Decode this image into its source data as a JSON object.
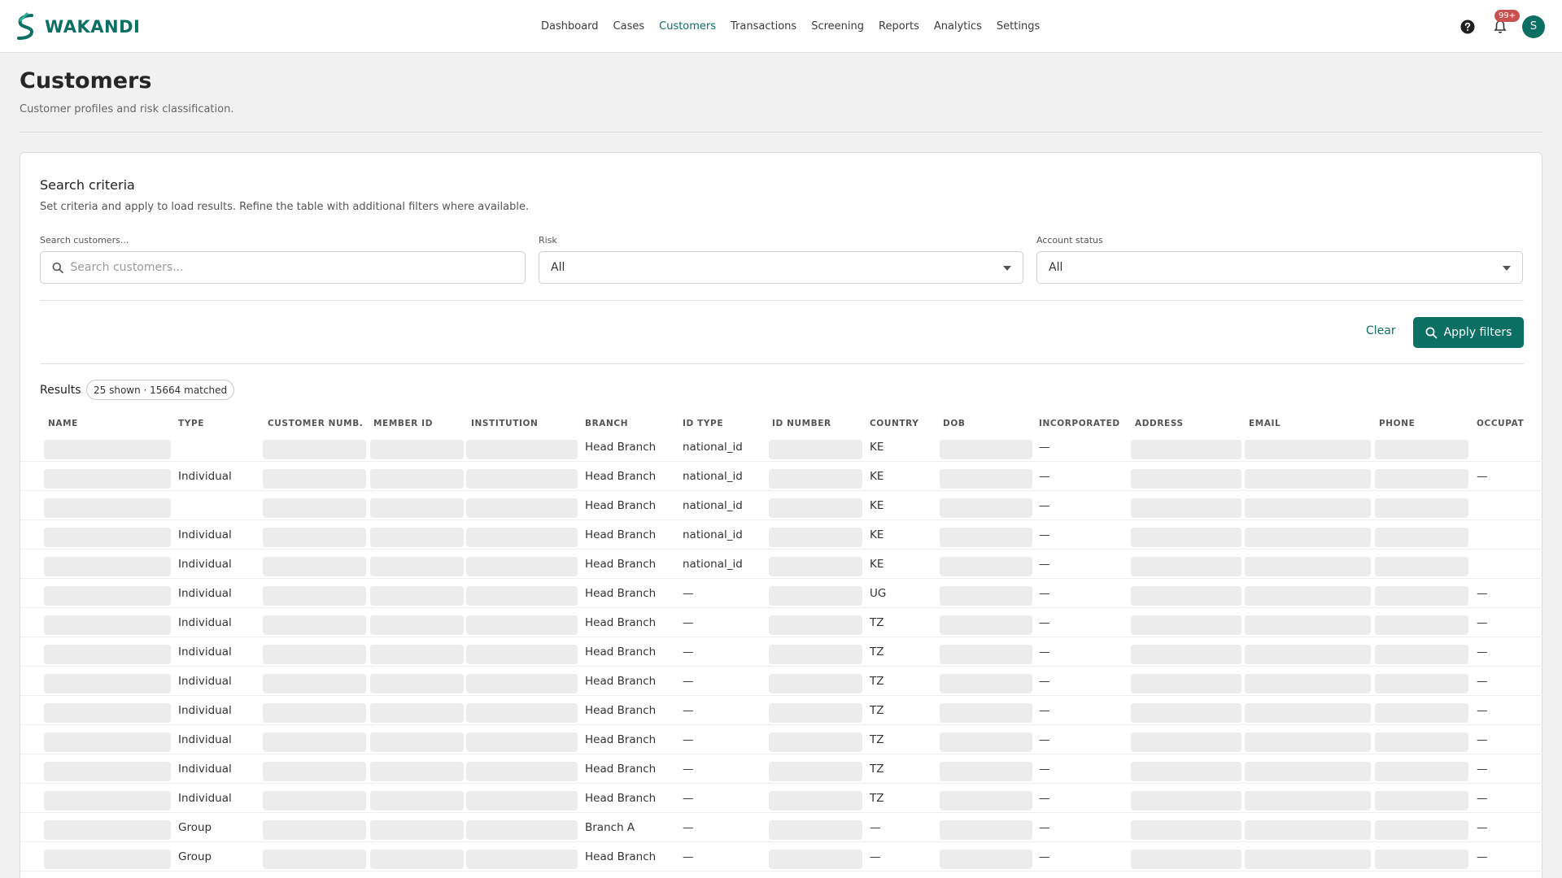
{
  "app": {
    "brand_name": "WAKANDI",
    "accent_color": "#0b6f63"
  },
  "nav": {
    "links": [
      {
        "label": "Dashboard",
        "active": false
      },
      {
        "label": "Cases",
        "active": false
      },
      {
        "label": "Customers",
        "active": true
      },
      {
        "label": "Transactions",
        "active": false
      },
      {
        "label": "Screening",
        "active": false
      },
      {
        "label": "Reports",
        "active": false
      },
      {
        "label": "Analytics",
        "active": false
      },
      {
        "label": "Settings",
        "active": false
      }
    ],
    "help_icon": "help-circle-icon",
    "bell_icon": "bell-icon",
    "notification_count": "99+",
    "avatar_initial": "S"
  },
  "page": {
    "title": "Customers",
    "subtitle": "Customer profiles and risk classification."
  },
  "search": {
    "title": "Search criteria",
    "description": "Set criteria and apply to load results. Refine the table with additional filters where available.",
    "query_label": "Search customers...",
    "query_placeholder": "Search customers...",
    "query_value": "",
    "risk_label": "Risk",
    "risk_value": "All",
    "status_label": "Account status",
    "status_value": "All",
    "clear_label": "Clear",
    "apply_label": "Apply filters"
  },
  "results": {
    "label": "Results",
    "summary": "25 shown · 15664 matched"
  },
  "table": {
    "columns": [
      "NAME",
      "TYPE",
      "CUSTOMER NUMB...",
      "MEMBER ID",
      "INSTITUTION",
      "BRANCH",
      "ID TYPE",
      "ID NUMBER",
      "COUNTRY",
      "DOB",
      "INCORPORATED",
      "ADDRESS",
      "EMAIL",
      "PHONE",
      "OCCUPAT"
    ],
    "rows": [
      {
        "type": "",
        "branch": "Head Branch",
        "id_type": "national_id",
        "country": "KE",
        "incorporated": "—",
        "occupation": ""
      },
      {
        "type": "Individual",
        "branch": "Head Branch",
        "id_type": "national_id",
        "country": "KE",
        "incorporated": "—",
        "occupation": "—"
      },
      {
        "type": "",
        "branch": "Head Branch",
        "id_type": "national_id",
        "country": "KE",
        "incorporated": "—",
        "occupation": ""
      },
      {
        "type": "Individual",
        "branch": "Head Branch",
        "id_type": "national_id",
        "country": "KE",
        "incorporated": "—",
        "occupation": ""
      },
      {
        "type": "Individual",
        "branch": "Head Branch",
        "id_type": "national_id",
        "country": "KE",
        "incorporated": "—",
        "occupation": ""
      },
      {
        "type": "Individual",
        "branch": "Head Branch",
        "id_type": "—",
        "country": "UG",
        "incorporated": "—",
        "occupation": "—"
      },
      {
        "type": "Individual",
        "branch": "Head Branch",
        "id_type": "—",
        "country": "TZ",
        "incorporated": "—",
        "occupation": "—"
      },
      {
        "type": "Individual",
        "branch": "Head Branch",
        "id_type": "—",
        "country": "TZ",
        "incorporated": "—",
        "occupation": "—"
      },
      {
        "type": "Individual",
        "branch": "Head Branch",
        "id_type": "—",
        "country": "TZ",
        "incorporated": "—",
        "occupation": "—"
      },
      {
        "type": "Individual",
        "branch": "Head Branch",
        "id_type": "—",
        "country": "TZ",
        "incorporated": "—",
        "occupation": "—"
      },
      {
        "type": "Individual",
        "branch": "Head Branch",
        "id_type": "—",
        "country": "TZ",
        "incorporated": "—",
        "occupation": "—"
      },
      {
        "type": "Individual",
        "branch": "Head Branch",
        "id_type": "—",
        "country": "TZ",
        "incorporated": "—",
        "occupation": "—"
      },
      {
        "type": "Individual",
        "branch": "Head Branch",
        "id_type": "—",
        "country": "TZ",
        "incorporated": "—",
        "occupation": "—"
      },
      {
        "type": "Group",
        "branch": "Branch A",
        "id_type": "—",
        "country": "—",
        "incorporated": "—",
        "occupation": "—"
      },
      {
        "type": "Group",
        "branch": "Head Branch",
        "id_type": "—",
        "country": "—",
        "incorporated": "—",
        "occupation": "—"
      }
    ]
  }
}
